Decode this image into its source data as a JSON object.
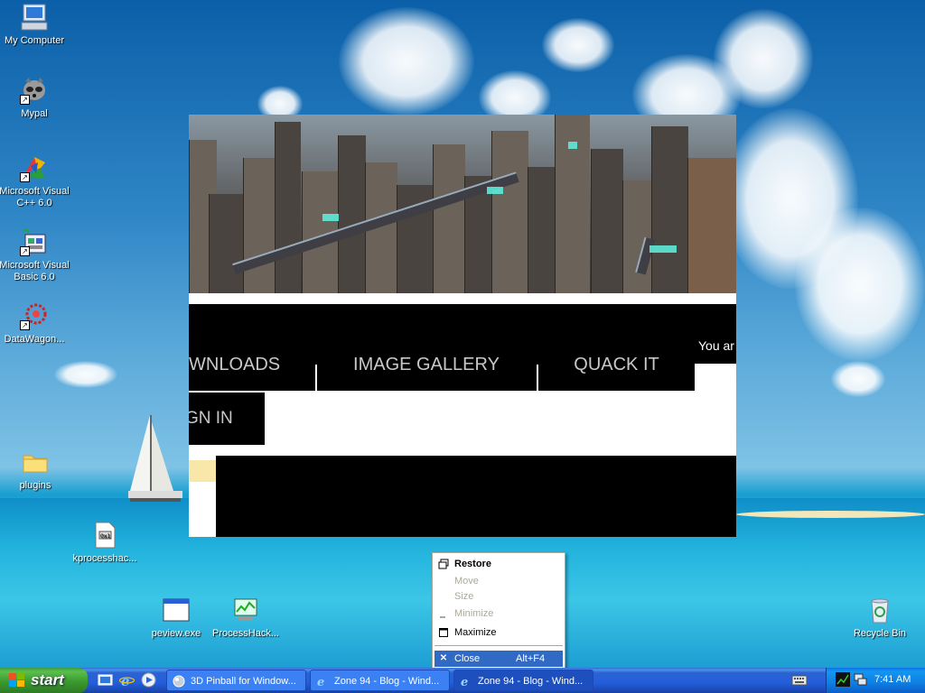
{
  "desktop": {
    "icons": [
      {
        "label": "My Computer",
        "icon": "computer-icon",
        "shortcut": false
      },
      {
        "label": "Mypal",
        "icon": "raccoon-icon",
        "shortcut": true
      },
      {
        "label": "Microsoft Visual C++ 6.0",
        "icon": "visual-cpp-icon",
        "shortcut": true
      },
      {
        "label": "Microsoft Visual Basic 6.0",
        "icon": "visual-basic-icon",
        "shortcut": true
      },
      {
        "label": "DataWagon...",
        "icon": "datawagon-icon",
        "shortcut": true
      },
      {
        "label": "plugins",
        "icon": "folder-icon",
        "shortcut": false
      },
      {
        "label": "kprocesshac...",
        "icon": "sys-file-icon",
        "shortcut": false
      },
      {
        "label": "peview.exe",
        "icon": "exe-window-icon",
        "shortcut": false
      },
      {
        "label": "ProcessHack...",
        "icon": "process-hacker-icon",
        "shortcut": false
      },
      {
        "label": "Recycle Bin",
        "icon": "recycle-bin-icon",
        "shortcut": false
      }
    ]
  },
  "website": {
    "nav": [
      "WNLOADS",
      "IMAGE GALLERY",
      "QUACK IT"
    ],
    "user_text": "You ar",
    "signin_label": "GN IN"
  },
  "context_menu": {
    "items": [
      {
        "label": "Restore",
        "enabled": true,
        "bold": true,
        "icon": "restore-icon"
      },
      {
        "label": "Move",
        "enabled": false
      },
      {
        "label": "Size",
        "enabled": false
      },
      {
        "label": "Minimize",
        "enabled": false,
        "icon": "minimize-icon"
      },
      {
        "label": "Maximize",
        "enabled": true,
        "icon": "maximize-icon"
      },
      {
        "label": "Close",
        "shortcut": "Alt+F4",
        "enabled": true,
        "selected": true,
        "icon": "close-icon"
      }
    ]
  },
  "taskbar": {
    "start_label": "start",
    "quick_launch": [
      "show-desktop-icon",
      "internet-explorer-icon",
      "media-player-icon"
    ],
    "buttons": [
      {
        "label": "3D Pinball for Window...",
        "icon": "pinball-icon",
        "active": false
      },
      {
        "label": "Zone 94 - Blog - Wind...",
        "icon": "internet-explorer-icon",
        "active": false
      },
      {
        "label": "Zone 94 - Blog - Wind...",
        "icon": "internet-explorer-icon",
        "active": true
      }
    ],
    "tray_icons": [
      "keyboard-icon",
      "process-monitor-icon",
      "network-icon"
    ],
    "clock": "7:41 AM"
  },
  "colors": {
    "menu_highlight": "#316ac5",
    "taskbar_blue": "#245edb",
    "start_green": "#3b9a2f",
    "disabled_text": "#aca899"
  }
}
